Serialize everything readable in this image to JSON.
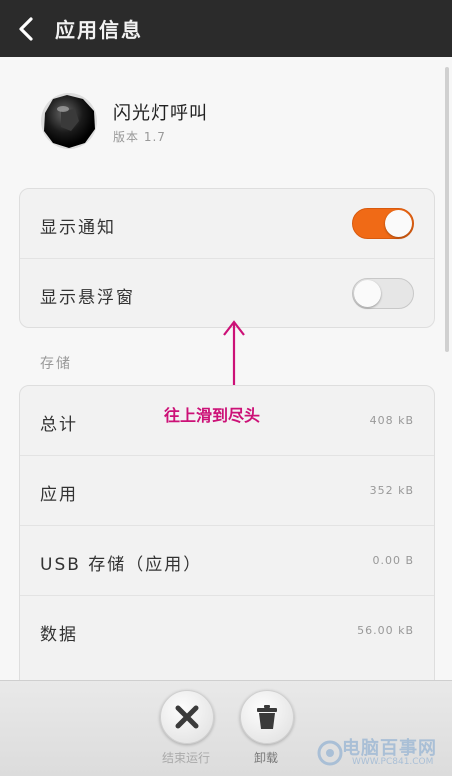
{
  "header": {
    "title": "应用信息",
    "back_icon": "chevron-left-icon"
  },
  "app": {
    "name": "闪光灯呼叫",
    "version": "版本 1.7",
    "icon": "app-icon-black-sphere"
  },
  "settings": [
    {
      "label": "显示通知",
      "enabled": true
    },
    {
      "label": "显示悬浮窗",
      "enabled": false
    }
  ],
  "storage": {
    "section_title": "存储",
    "rows": [
      {
        "label": "总计",
        "value": "408 kB"
      },
      {
        "label": "应用",
        "value": "352 kB"
      },
      {
        "label": "USB 存储（应用）",
        "value": "0.00 B"
      },
      {
        "label": "数据",
        "value": "56.00 kB"
      }
    ]
  },
  "annotation": {
    "text": "往上滑到尽头",
    "color": "#cc1177"
  },
  "actions": [
    {
      "label": "结束运行",
      "icon": "close-x-icon"
    },
    {
      "label": "卸载",
      "icon": "trash-icon"
    }
  ],
  "watermark": {
    "text": "电脑百事网",
    "url": "WWW.PC841.COM"
  },
  "colors": {
    "accent": "#f06a16",
    "titlebar": "#2b2b2b"
  }
}
